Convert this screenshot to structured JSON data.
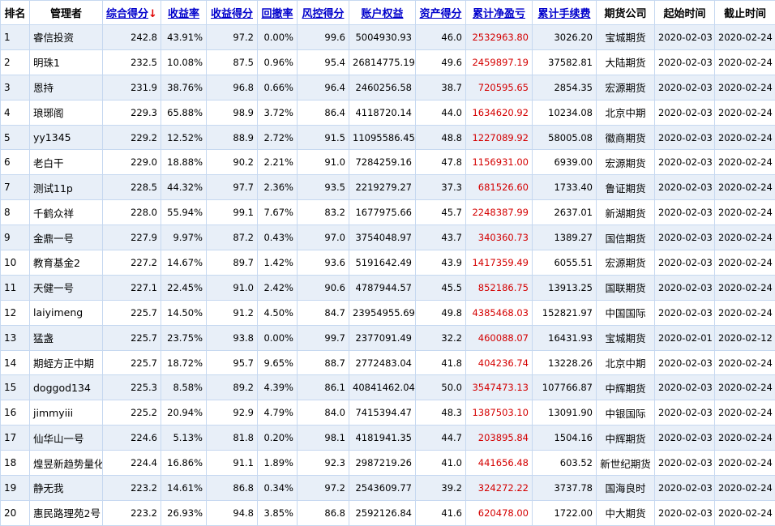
{
  "header": {
    "rank": "排名",
    "manager": "管理者",
    "score": "综合得分",
    "sort_arrow": "↓",
    "return_rate": "收益率",
    "return_score": "收益得分",
    "drawdown": "回撤率",
    "risk_score": "风控得分",
    "equity": "账户权益",
    "asset_score": "资产得分",
    "net_profit": "累计净盈亏",
    "fees": "累计手续费",
    "broker": "期货公司",
    "start": "起始时间",
    "end": "截止时间"
  },
  "rows": [
    {
      "rank": "1",
      "manager": "睿信投资",
      "score": "242.8",
      "return_rate": "43.91%",
      "return_score": "97.2",
      "drawdown": "0.00%",
      "risk_score": "99.6",
      "equity": "5004930.93",
      "asset_score": "46.0",
      "net_profit": "2532963.80",
      "fees": "3026.20",
      "broker": "宝城期货",
      "start": "2020-02-03",
      "end": "2020-02-24"
    },
    {
      "rank": "2",
      "manager": "明珠1",
      "score": "232.5",
      "return_rate": "10.08%",
      "return_score": "87.5",
      "drawdown": "0.96%",
      "risk_score": "95.4",
      "equity": "26814775.19",
      "asset_score": "49.6",
      "net_profit": "2459897.19",
      "fees": "37582.81",
      "broker": "大陆期货",
      "start": "2020-02-03",
      "end": "2020-02-24"
    },
    {
      "rank": "3",
      "manager": "恩持",
      "score": "231.9",
      "return_rate": "38.76%",
      "return_score": "96.8",
      "drawdown": "0.66%",
      "risk_score": "96.4",
      "equity": "2460256.58",
      "asset_score": "38.7",
      "net_profit": "720595.65",
      "fees": "2854.35",
      "broker": "宏源期货",
      "start": "2020-02-03",
      "end": "2020-02-24"
    },
    {
      "rank": "4",
      "manager": "琅琊阁",
      "score": "229.3",
      "return_rate": "65.88%",
      "return_score": "98.9",
      "drawdown": "3.72%",
      "risk_score": "86.4",
      "equity": "4118720.14",
      "asset_score": "44.0",
      "net_profit": "1634620.92",
      "fees": "10234.08",
      "broker": "北京中期",
      "start": "2020-02-03",
      "end": "2020-02-24"
    },
    {
      "rank": "5",
      "manager": "yy1345",
      "score": "229.2",
      "return_rate": "12.52%",
      "return_score": "88.9",
      "drawdown": "2.72%",
      "risk_score": "91.5",
      "equity": "11095586.45",
      "asset_score": "48.8",
      "net_profit": "1227089.92",
      "fees": "58005.08",
      "broker": "徽商期货",
      "start": "2020-02-03",
      "end": "2020-02-24"
    },
    {
      "rank": "6",
      "manager": "老白干",
      "score": "229.0",
      "return_rate": "18.88%",
      "return_score": "90.2",
      "drawdown": "2.21%",
      "risk_score": "91.0",
      "equity": "7284259.16",
      "asset_score": "47.8",
      "net_profit": "1156931.00",
      "fees": "6939.00",
      "broker": "宏源期货",
      "start": "2020-02-03",
      "end": "2020-02-24"
    },
    {
      "rank": "7",
      "manager": "测试11p",
      "score": "228.5",
      "return_rate": "44.32%",
      "return_score": "97.7",
      "drawdown": "2.36%",
      "risk_score": "93.5",
      "equity": "2219279.27",
      "asset_score": "37.3",
      "net_profit": "681526.60",
      "fees": "1733.40",
      "broker": "鲁证期货",
      "start": "2020-02-03",
      "end": "2020-02-24"
    },
    {
      "rank": "8",
      "manager": "千鹤众祥",
      "score": "228.0",
      "return_rate": "55.94%",
      "return_score": "99.1",
      "drawdown": "7.67%",
      "risk_score": "83.2",
      "equity": "1677975.66",
      "asset_score": "45.7",
      "net_profit": "2248387.99",
      "fees": "2637.01",
      "broker": "新湖期货",
      "start": "2020-02-03",
      "end": "2020-02-24"
    },
    {
      "rank": "9",
      "manager": "金鼎一号",
      "score": "227.9",
      "return_rate": "9.97%",
      "return_score": "87.2",
      "drawdown": "0.43%",
      "risk_score": "97.0",
      "equity": "3754048.97",
      "asset_score": "43.7",
      "net_profit": "340360.73",
      "fees": "1389.27",
      "broker": "国信期货",
      "start": "2020-02-03",
      "end": "2020-02-24"
    },
    {
      "rank": "10",
      "manager": "教育基金2",
      "score": "227.2",
      "return_rate": "14.67%",
      "return_score": "89.7",
      "drawdown": "1.42%",
      "risk_score": "93.6",
      "equity": "5191642.49",
      "asset_score": "43.9",
      "net_profit": "1417359.49",
      "fees": "6055.51",
      "broker": "宏源期货",
      "start": "2020-02-03",
      "end": "2020-02-24"
    },
    {
      "rank": "11",
      "manager": "天健一号",
      "score": "227.1",
      "return_rate": "22.45%",
      "return_score": "91.0",
      "drawdown": "2.42%",
      "risk_score": "90.6",
      "equity": "4787944.57",
      "asset_score": "45.5",
      "net_profit": "852186.75",
      "fees": "13913.25",
      "broker": "国联期货",
      "start": "2020-02-03",
      "end": "2020-02-24"
    },
    {
      "rank": "12",
      "manager": "laiyimeng",
      "score": "225.7",
      "return_rate": "14.50%",
      "return_score": "91.2",
      "drawdown": "4.50%",
      "risk_score": "84.7",
      "equity": "23954955.69",
      "asset_score": "49.8",
      "net_profit": "4385468.03",
      "fees": "152821.97",
      "broker": "中国国际",
      "start": "2020-02-03",
      "end": "2020-02-24"
    },
    {
      "rank": "13",
      "manager": "猛盏",
      "score": "225.7",
      "return_rate": "23.75%",
      "return_score": "93.8",
      "drawdown": "0.00%",
      "risk_score": "99.7",
      "equity": "2377091.49",
      "asset_score": "32.2",
      "net_profit": "460088.07",
      "fees": "16431.93",
      "broker": "宝城期货",
      "start": "2020-02-01",
      "end": "2020-02-12"
    },
    {
      "rank": "14",
      "manager": "期蛭方正中期",
      "score": "225.7",
      "return_rate": "18.72%",
      "return_score": "95.7",
      "drawdown": "9.65%",
      "risk_score": "88.7",
      "equity": "2772483.04",
      "asset_score": "41.8",
      "net_profit": "404236.74",
      "fees": "13228.26",
      "broker": "北京中期",
      "start": "2020-02-03",
      "end": "2020-02-24"
    },
    {
      "rank": "15",
      "manager": "doggod134",
      "score": "225.3",
      "return_rate": "8.58%",
      "return_score": "89.2",
      "drawdown": "4.39%",
      "risk_score": "86.1",
      "equity": "40841462.04",
      "asset_score": "50.0",
      "net_profit": "3547473.13",
      "fees": "107766.87",
      "broker": "中辉期货",
      "start": "2020-02-03",
      "end": "2020-02-24"
    },
    {
      "rank": "16",
      "manager": "jimmyiii",
      "score": "225.2",
      "return_rate": "20.94%",
      "return_score": "92.9",
      "drawdown": "4.79%",
      "risk_score": "84.0",
      "equity": "7415394.47",
      "asset_score": "48.3",
      "net_profit": "1387503.10",
      "fees": "13091.90",
      "broker": "中银国际",
      "start": "2020-02-03",
      "end": "2020-02-24"
    },
    {
      "rank": "17",
      "manager": "仙华山一号",
      "score": "224.6",
      "return_rate": "5.13%",
      "return_score": "81.8",
      "drawdown": "0.20%",
      "risk_score": "98.1",
      "equity": "4181941.35",
      "asset_score": "44.7",
      "net_profit": "203895.84",
      "fees": "1504.16",
      "broker": "中辉期货",
      "start": "2020-02-03",
      "end": "2020-02-24"
    },
    {
      "rank": "18",
      "manager": "煌昱新趋势量化",
      "score": "224.4",
      "return_rate": "16.86%",
      "return_score": "91.1",
      "drawdown": "1.89%",
      "risk_score": "92.3",
      "equity": "2987219.26",
      "asset_score": "41.0",
      "net_profit": "441656.48",
      "fees": "603.52",
      "broker": "新世纪期货",
      "start": "2020-02-03",
      "end": "2020-02-24"
    },
    {
      "rank": "19",
      "manager": "静无我",
      "score": "223.2",
      "return_rate": "14.61%",
      "return_score": "86.8",
      "drawdown": "0.34%",
      "risk_score": "97.2",
      "equity": "2543609.77",
      "asset_score": "39.2",
      "net_profit": "324272.22",
      "fees": "3737.78",
      "broker": "国海良时",
      "start": "2020-02-03",
      "end": "2020-02-24"
    },
    {
      "rank": "20",
      "manager": "惠民路理苑2号",
      "score": "223.2",
      "return_rate": "26.93%",
      "return_score": "94.8",
      "drawdown": "3.85%",
      "risk_score": "86.8",
      "equity": "2592126.84",
      "asset_score": "41.6",
      "net_profit": "620478.00",
      "fees": "1722.00",
      "broker": "中大期货",
      "start": "2020-02-03",
      "end": "2020-02-24"
    }
  ],
  "colors": {
    "link_header": "#0000cc",
    "profit_red": "#d40000",
    "row_stripe": "#e8eff8",
    "grid_line": "#c6d8f0"
  }
}
